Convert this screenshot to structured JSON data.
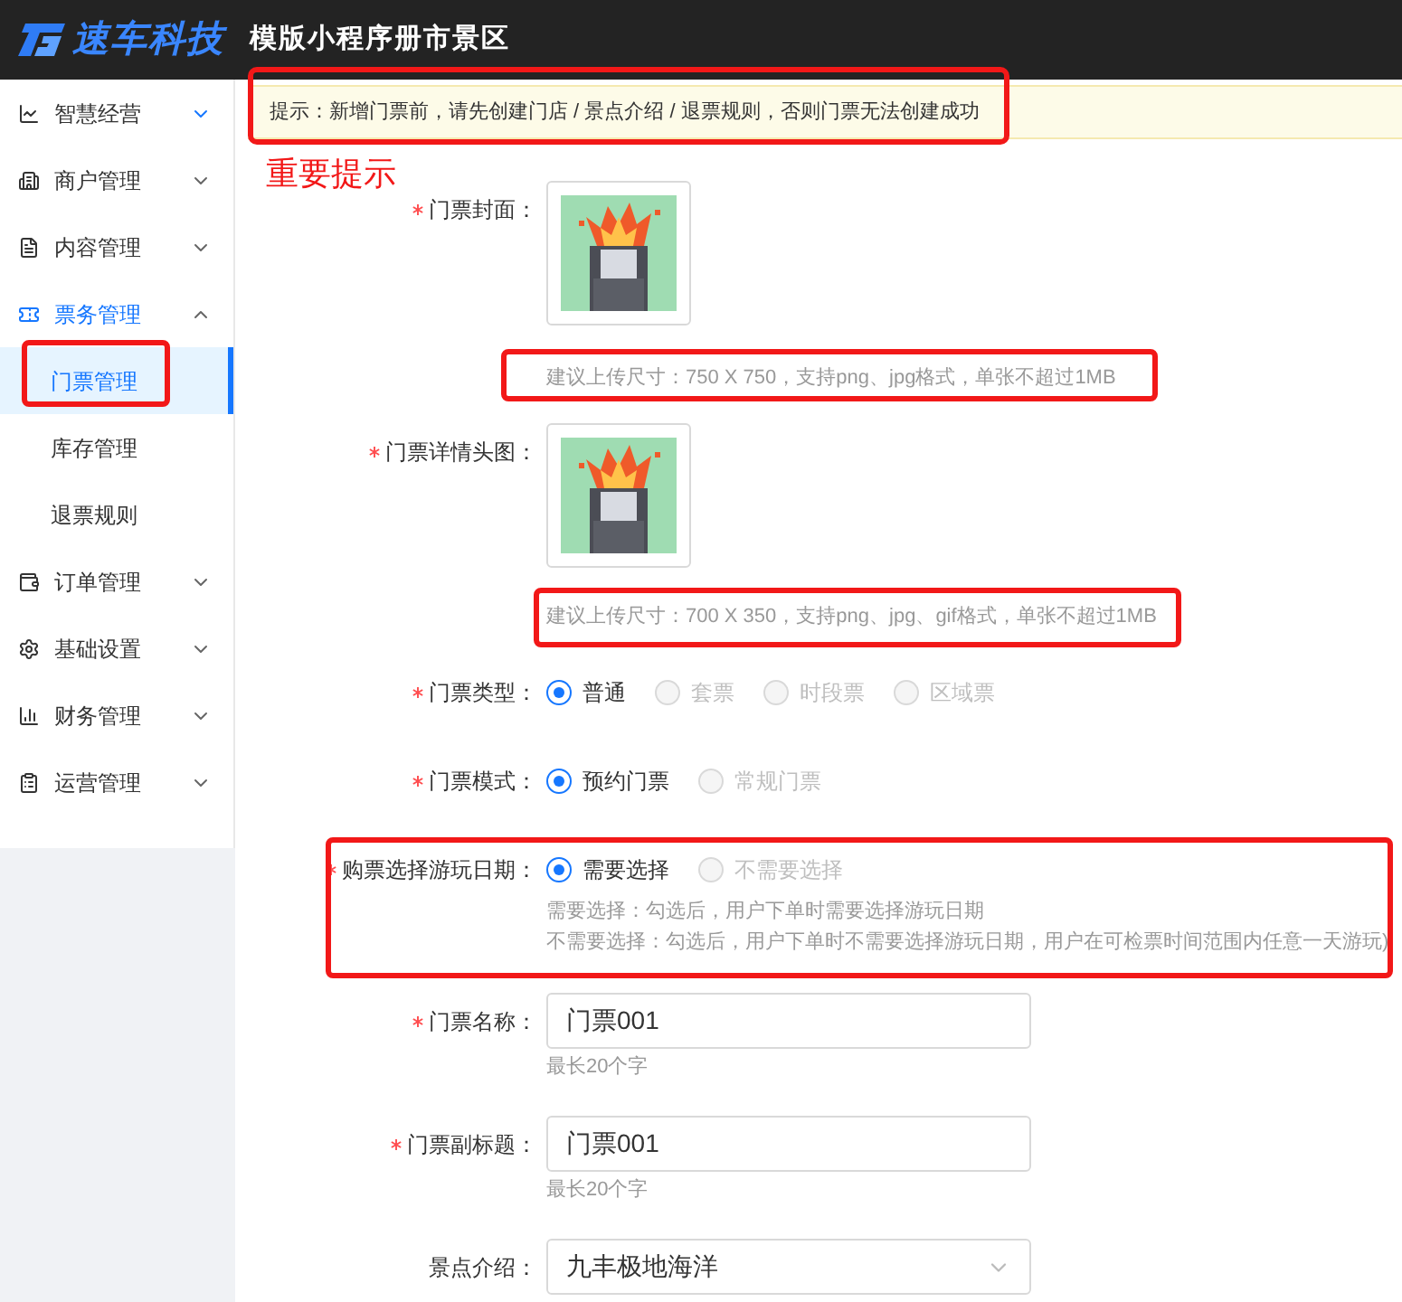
{
  "header": {
    "logo_text": "速车科技",
    "title": "模版小程序册市景区"
  },
  "sidebar": {
    "items": [
      {
        "label": "智慧经营",
        "expanded": false,
        "chevron_highlighted": true
      },
      {
        "label": "商户管理",
        "expanded": false,
        "chevron_highlighted": false
      },
      {
        "label": "内容管理",
        "expanded": false,
        "chevron_highlighted": false
      },
      {
        "label": "票务管理",
        "expanded": true,
        "chevron_highlighted": false,
        "children": [
          {
            "label": "门票管理",
            "selected": true,
            "annotated": true
          },
          {
            "label": "库存管理",
            "selected": false,
            "annotated": false
          },
          {
            "label": "退票规则",
            "selected": false,
            "annotated": false
          }
        ]
      },
      {
        "label": "订单管理",
        "expanded": false,
        "chevron_highlighted": false
      },
      {
        "label": "基础设置",
        "expanded": false,
        "chevron_highlighted": false
      },
      {
        "label": "财务管理",
        "expanded": false,
        "chevron_highlighted": false
      },
      {
        "label": "运营管理",
        "expanded": false,
        "chevron_highlighted": false
      }
    ]
  },
  "notice": {
    "text": "提示：新增门票前，请先创建门店 / 景点介绍 / 退票规则，否则门票无法创建成功",
    "annotated": true
  },
  "annotation_note": "重要提示",
  "form": {
    "fields": [
      {
        "label": "门票封面：",
        "required": true,
        "image": {
          "kind": "picture"
        },
        "hints": [
          "建议上传尺寸：750 X 750，支持png、jpg格式，单张不超过1MB"
        ],
        "annotated": true
      },
      {
        "label": "门票详情头图：",
        "required": true,
        "image": {
          "kind": "picture"
        },
        "hints": [
          "建议上传尺寸：700 X 350，支持png、jpg、gif格式，单张不超过1MB"
        ],
        "annotated": true
      },
      {
        "kind": "radio",
        "label": "门票类型：",
        "required": true,
        "options": [
          {
            "label": "普通",
            "selected": true,
            "disabled": false
          },
          {
            "label": "套票",
            "selected": false,
            "disabled": true
          },
          {
            "label": "时段票",
            "selected": false,
            "disabled": true
          },
          {
            "label": "区域票",
            "selected": false,
            "disabled": true
          }
        ],
        "annotated": false
      },
      {
        "kind": "radio",
        "label": "门票模式：",
        "required": true,
        "options": [
          {
            "label": "预约门票",
            "selected": true,
            "disabled": false
          },
          {
            "label": "常规门票",
            "selected": false,
            "disabled": true
          }
        ],
        "annotated": false
      },
      {
        "kind": "radio",
        "label": "购票选择游玩日期：",
        "required": true,
        "options": [
          {
            "label": "需要选择",
            "selected": true,
            "disabled": false
          },
          {
            "label": "不需要选择",
            "selected": false,
            "disabled": true
          }
        ],
        "hints": [
          "需要选择：勾选后，用户下单时需要选择游玩日期",
          "不需要选择：勾选后，用户下单时不需要选择游玩日期，用户在可检票时间范围内任意一天游玩)"
        ],
        "annotated": true
      },
      {
        "kind": "text",
        "label": "门票名称：",
        "required": true,
        "value": "门票001",
        "hints": [
          "最长20个字"
        ],
        "annotated": false
      },
      {
        "kind": "text",
        "label": "门票副标题：",
        "required": true,
        "value": "门票001",
        "hints": [
          "最长20个字"
        ],
        "annotated": false
      },
      {
        "kind": "select",
        "label": "景点介绍：",
        "required": false,
        "value": "九丰极地海洋",
        "annotated": false
      }
    ]
  }
}
